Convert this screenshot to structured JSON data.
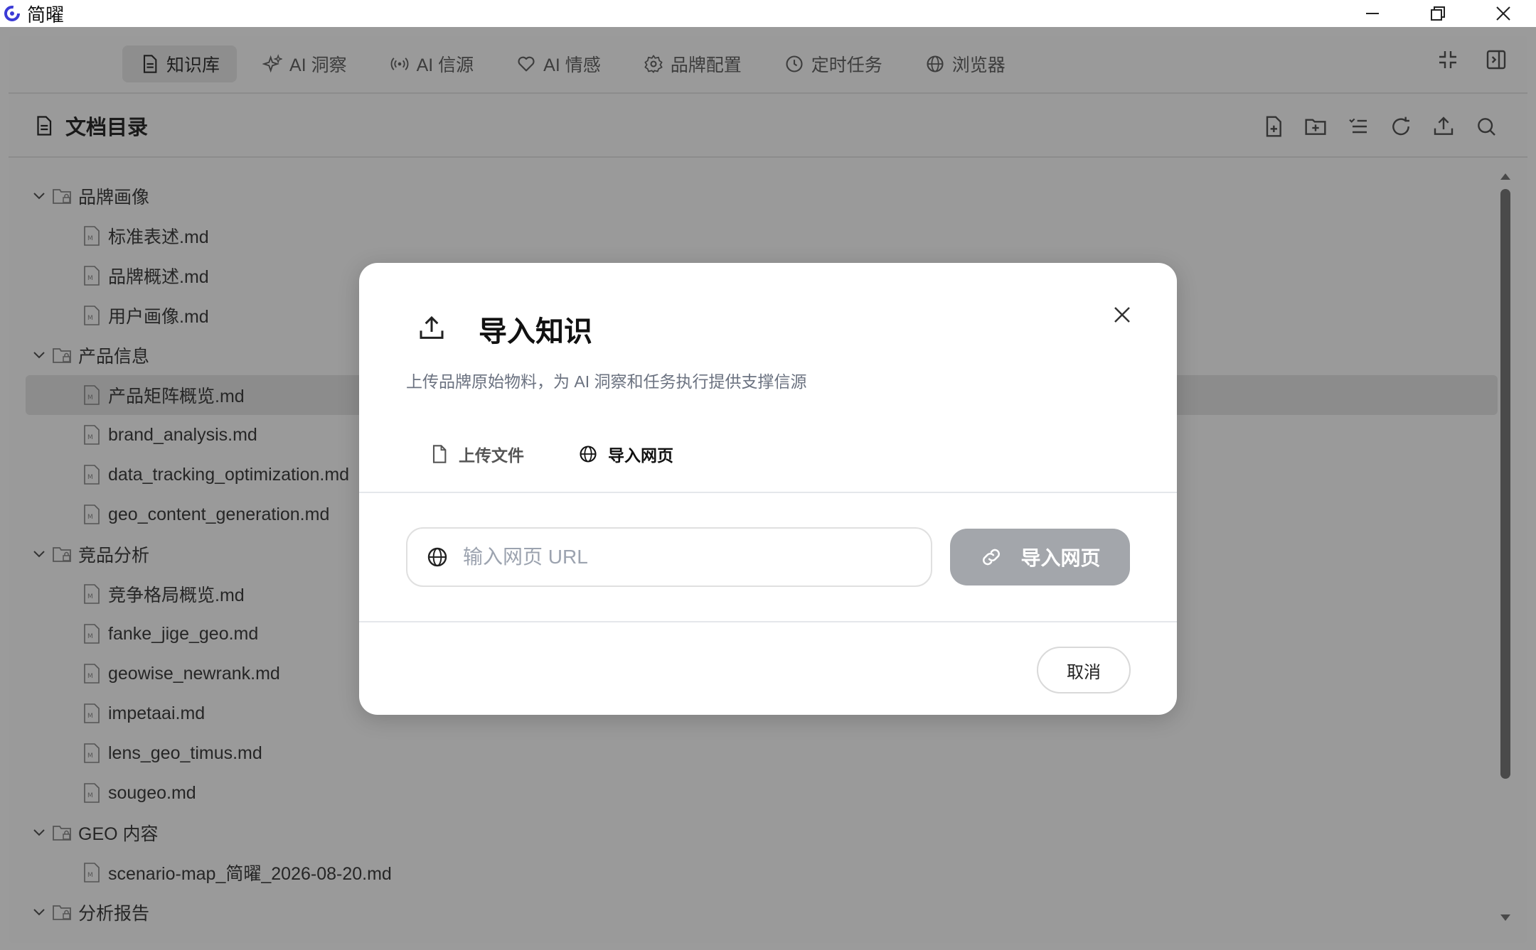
{
  "window": {
    "title": "简曜"
  },
  "nav": {
    "tabs": [
      {
        "label": "知识库",
        "icon": "document-icon",
        "active": true
      },
      {
        "label": "AI 洞察",
        "icon": "sparkle-icon",
        "active": false
      },
      {
        "label": "AI 信源",
        "icon": "broadcast-icon",
        "active": false
      },
      {
        "label": "AI 情感",
        "icon": "heart-icon",
        "active": false
      },
      {
        "label": "品牌配置",
        "icon": "gear-icon",
        "active": false
      },
      {
        "label": "定时任务",
        "icon": "clock-icon",
        "active": false
      },
      {
        "label": "浏览器",
        "icon": "globe-icon",
        "active": false
      }
    ]
  },
  "doc_panel": {
    "title": "文档目录"
  },
  "tree": {
    "folders": [
      {
        "name": "品牌画像",
        "files": [
          "标准表述.md",
          "品牌概述.md",
          "用户画像.md"
        ]
      },
      {
        "name": "产品信息",
        "files": [
          "产品矩阵概览.md",
          "brand_analysis.md",
          "data_tracking_optimization.md",
          "geo_content_generation.md"
        ]
      },
      {
        "name": "竞品分析",
        "files": [
          "竞争格局概览.md",
          "fanke_jige_geo.md",
          "geowise_newrank.md",
          "impetaai.md",
          "lens_geo_timus.md",
          "sougeo.md"
        ]
      },
      {
        "name": "GEO 内容",
        "files": [
          "scenario-map_简曜_2026-08-20.md"
        ]
      },
      {
        "name": "分析报告",
        "files": []
      }
    ],
    "selected_file": "产品矩阵概览.md"
  },
  "modal": {
    "title": "导入知识",
    "subtitle": "上传品牌原始物料，为 AI 洞察和任务执行提供支撑信源",
    "tab_upload": "上传文件",
    "tab_web": "导入网页",
    "active_tab": "导入网页",
    "url_placeholder": "输入网页 URL",
    "url_value": "",
    "import_button": "导入网页",
    "cancel_button": "取消"
  },
  "colors": {
    "overlay": "#9b9b9b",
    "modal_bg": "#ffffff",
    "import_button_bg": "#a3a6ab"
  }
}
